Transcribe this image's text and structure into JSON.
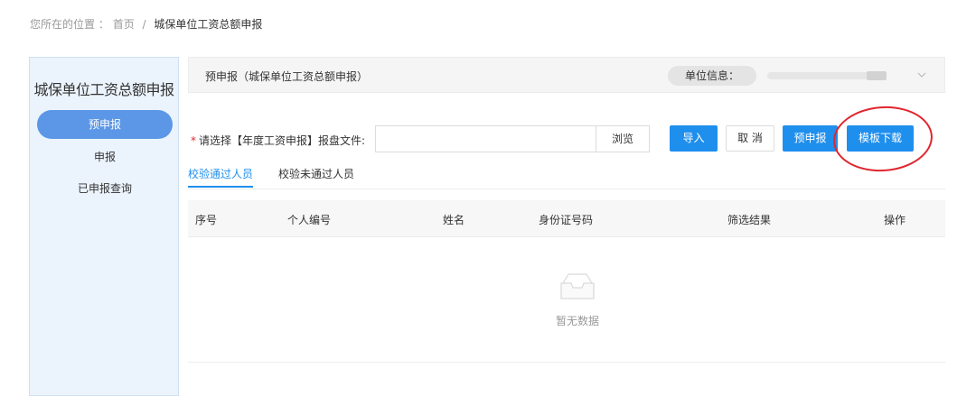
{
  "breadcrumb": {
    "prefix": "您所在的位置",
    "colon": "：",
    "home": "首页",
    "separator": "/",
    "current": "城保单位工资总额申报"
  },
  "sidebar": {
    "title": "城保单位工资总额申报",
    "items": [
      {
        "label": "预申报",
        "active": true
      },
      {
        "label": "申报",
        "active": false
      },
      {
        "label": "已申报查询",
        "active": false
      }
    ]
  },
  "panel": {
    "title": "预申报（城保单位工资总额申报）",
    "unit_info_label": "单位信息：",
    "unit_value": "",
    "dropdown_icon": "chevron-down-icon"
  },
  "upload": {
    "required_mark": "*",
    "label": "请选择【年度工资申报】报盘文件:",
    "file_value": "",
    "browse_label": "浏览"
  },
  "actions": {
    "import_label": "导入",
    "cancel_label": "取 消",
    "pre_declare_label": "预申报",
    "template_download_label": "模板下载"
  },
  "tabs": [
    {
      "label": "校验通过人员",
      "active": true
    },
    {
      "label": "校验未通过人员",
      "active": false
    }
  ],
  "table": {
    "columns": [
      "序号",
      "个人编号",
      "姓名",
      "身份证号码",
      "筛选结果",
      "操作"
    ],
    "rows": [],
    "empty_text": "暂无数据",
    "empty_icon": "empty-inbox-icon"
  },
  "colors": {
    "primary": "#1f8fed",
    "sidebar_active": "#5b97e6",
    "sidebar_bg": "#ebf3fc",
    "annotation_circle": "#e0262f",
    "required_star": "#e0262f"
  }
}
